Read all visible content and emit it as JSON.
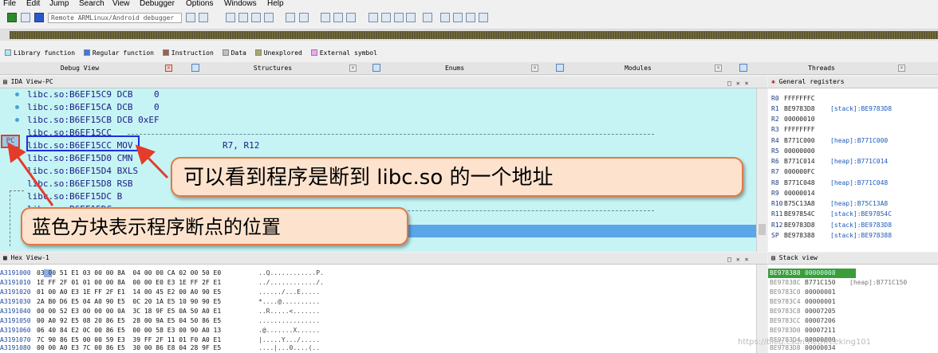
{
  "menu": [
    "File",
    "Edit",
    "Jump",
    "Search",
    "View",
    "Debugger",
    "Options",
    "Windows",
    "Help"
  ],
  "toolbar": {
    "debugger_combo": "Remote ARMLinux/Android debugger"
  },
  "legend": [
    {
      "label": "Library function",
      "color": "#aee8f6"
    },
    {
      "label": "Regular function",
      "color": "#3b7be0"
    },
    {
      "label": "Instruction",
      "color": "#a0604a"
    },
    {
      "label": "Data",
      "color": "#c0c0c0"
    },
    {
      "label": "Unexplored",
      "color": "#a8a86a"
    },
    {
      "label": "External symbol",
      "color": "#f4a6f4"
    }
  ],
  "tabs": [
    "Debug View",
    "Structures",
    "Enums",
    "Modules",
    "Threads"
  ],
  "ida_view": {
    "title": "IDA View-PC",
    "lines": [
      {
        "addr": "libc.so:B6EF15C9",
        "text": " DCB    0"
      },
      {
        "addr": "libc.so:B6EF15CA",
        "text": " DCB    0"
      },
      {
        "addr": "libc.so:B6EF15CB",
        "text": " DCB 0xEF"
      },
      {
        "addr": "libc.so:B6EF15CC",
        "text": ""
      },
      {
        "addr": "libc.so:B6EF15CC",
        "text": " MOV                 R7, R12"
      },
      {
        "addr": "libc.so:B6EF15D0",
        "text": " CMN"
      },
      {
        "addr": "libc.so:B6EF15D4",
        "text": " BXLS"
      },
      {
        "addr": "libc.so:B6EF15D8",
        "text": " RSB"
      },
      {
        "addr": "libc.so:B6EF15DC",
        "text": " B"
      },
      {
        "addr": "libc.so:B6EF15DC",
        "text": ""
      }
    ],
    "pc_label": "PC"
  },
  "registers": {
    "title": "General registers",
    "rows": [
      {
        "name": "R0",
        "value": "FFFFFFFC",
        "ref": ""
      },
      {
        "name": "R1",
        "value": "BE9783D8",
        "ref": "[stack]:BE9783D8"
      },
      {
        "name": "R2",
        "value": "00000010",
        "ref": ""
      },
      {
        "name": "R3",
        "value": "FFFFFFFF",
        "ref": ""
      },
      {
        "name": "R4",
        "value": "B771C000",
        "ref": "[heap]:B771C000"
      },
      {
        "name": "R5",
        "value": "00000000",
        "ref": ""
      },
      {
        "name": "R6",
        "value": "B771C014",
        "ref": "[heap]:B771C014"
      },
      {
        "name": "R7",
        "value": "000000FC",
        "ref": ""
      },
      {
        "name": "R8",
        "value": "B771C048",
        "ref": "[heap]:B771C048"
      },
      {
        "name": "R9",
        "value": "00000014",
        "ref": ""
      },
      {
        "name": "R10",
        "value": "B75C13A8",
        "ref": "[heap]:B75C13A8"
      },
      {
        "name": "R11",
        "value": "BE97854C",
        "ref": "[stack]:BE97854C"
      },
      {
        "name": "R12",
        "value": "BE9783D8",
        "ref": "[stack]:BE9783D8"
      },
      {
        "name": "SP",
        "value": "BE978388",
        "ref": "[stack]:BE978388"
      }
    ]
  },
  "hex_view": {
    "title": "Hex View-1",
    "rows": [
      {
        "addr": "A3191000",
        "bytes": "03 00 51 E1 03 00 00 8A  04 00 00 CA 02 00 50 E0",
        "ascii": "..Q............P."
      },
      {
        "addr": "A3191010",
        "bytes": "1E FF 2F 01 01 00 00 8A  00 00 E0 E3 1E FF 2F E1",
        "ascii": "../............/."
      },
      {
        "addr": "A3191020",
        "bytes": "01 00 A0 E3 1E FF 2F E1  14 00 45 E2 00 A0 90 E5",
        "ascii": "....../...E....."
      },
      {
        "addr": "A3191030",
        "bytes": "2A B0 D6 E5 04 A0 90 E5  0C 20 1A E5 10 90 90 E5",
        "ascii": "*....@.........."
      },
      {
        "addr": "A3191040",
        "bytes": "00 00 52 E3 00 00 00 0A  3C 18 9F E5 0A 50 A0 E1",
        "ascii": "..R.....<......."
      },
      {
        "addr": "A3191050",
        "bytes": "00 A0 92 E5 08 20 86 E5  28 00 9A E5 04 50 86 E5",
        "ascii": "................"
      },
      {
        "addr": "A3191060",
        "bytes": "06 40 84 E2 0C 00 86 E5  00 00 58 E3 00 90 A0 13",
        "ascii": ".@.......X......"
      },
      {
        "addr": "A3191070",
        "bytes": "7C 90 86 E5 00 00 59 E3  39 FF 2F 11 01 F0 A0 E1",
        "ascii": "|.....Y.../....."
      },
      {
        "addr": "A3191080",
        "bytes": "00 00 A0 E3 7C 00 86 E5  30 00 86 E8 04 28 9F E5",
        "ascii": "....|...0....(.."
      }
    ]
  },
  "stack_view": {
    "title": "Stack view",
    "rows": [
      {
        "addr": "BE978388",
        "value": "00000008",
        "ref": ""
      },
      {
        "addr": "BE97838C",
        "value": "B771C150",
        "ref": "[heap]:B771C150"
      },
      {
        "addr": "BE9783C0",
        "value": "00000001",
        "ref": ""
      },
      {
        "addr": "BE9783C4",
        "value": "00000001",
        "ref": ""
      },
      {
        "addr": "BE9783C8",
        "value": "00007205",
        "ref": ""
      },
      {
        "addr": "BE9783CC",
        "value": "00007206",
        "ref": ""
      },
      {
        "addr": "BE9783D0",
        "value": "00007211",
        "ref": ""
      },
      {
        "addr": "BE9783D4",
        "value": "00000000",
        "ref": ""
      },
      {
        "addr": "BE9783D8",
        "value": "00000034",
        "ref": ""
      }
    ]
  },
  "annotations": {
    "callout1": "可以看到程序是断到 libc.so 的一个地址",
    "callout2": "蓝色方块表示程序断点的位置"
  },
  "watermark": "https://blog.csdn.net/freeking101"
}
